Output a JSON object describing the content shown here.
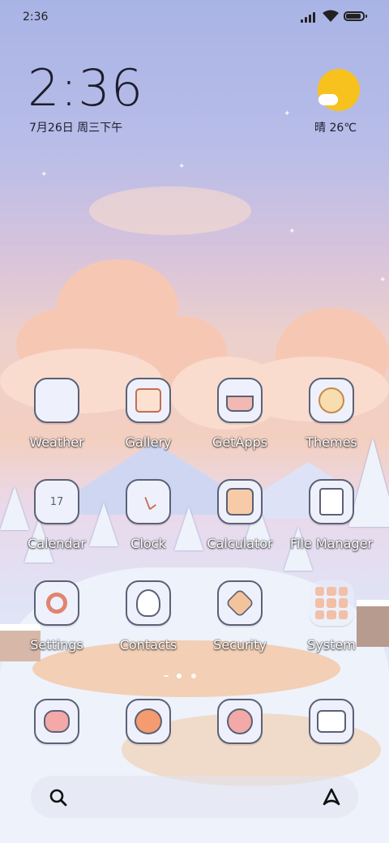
{
  "status_bar": {
    "time": "2:36"
  },
  "widget": {
    "clock": "2:36",
    "date": "7月26日 周三下午",
    "weather": "晴 26℃",
    "weather_icon": "sun-with-cloud-icon"
  },
  "apps": [
    {
      "label": "Weather",
      "icon": "weather-icon"
    },
    {
      "label": "Gallery",
      "icon": "gallery-icon"
    },
    {
      "label": "GetApps",
      "icon": "getapps-icon"
    },
    {
      "label": "Themes",
      "icon": "themes-icon"
    },
    {
      "label": "Calendar",
      "icon": "calendar-icon",
      "icon_text": "17"
    },
    {
      "label": "Clock",
      "icon": "clock-icon"
    },
    {
      "label": "Calculator",
      "icon": "calculator-icon"
    },
    {
      "label": "File Manager",
      "icon": "file-manager-icon"
    },
    {
      "label": "Settings",
      "icon": "settings-icon"
    },
    {
      "label": "Contacts",
      "icon": "contacts-icon"
    },
    {
      "label": "Security",
      "icon": "security-icon"
    },
    {
      "label": "System",
      "icon": "system-folder-icon"
    }
  ],
  "dock": [
    {
      "icon": "phone-icon"
    },
    {
      "icon": "messages-icon"
    },
    {
      "icon": "browser-icon"
    },
    {
      "icon": "camera-icon"
    }
  ],
  "page_indicator": {
    "current": 1,
    "pages": 2
  },
  "search_bar": {
    "left_icon": "search-icon",
    "right_icon": "assistant-icon"
  },
  "colors": {
    "accent": "#f7c21d",
    "tile_bg": "#eef1fb",
    "tile_border": "#5b6176"
  }
}
